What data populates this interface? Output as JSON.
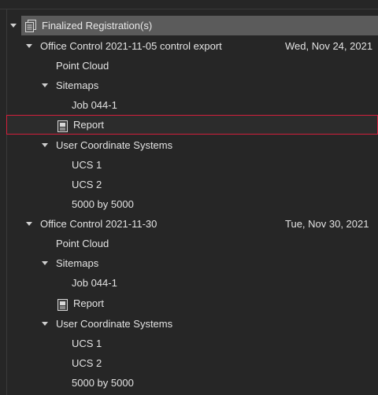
{
  "tree": {
    "root": {
      "label": "Finalized Registration(s)",
      "icon": "registration-document-icon",
      "expanded": true
    },
    "registrations": [
      {
        "title": "Office Control 2021-11-05 control export",
        "date": "Wed, Nov 24, 2021",
        "expanded": true,
        "point_cloud": "Point Cloud",
        "sitemaps": {
          "label": "Sitemaps",
          "expanded": true,
          "items": [
            "Job 044-1"
          ]
        },
        "report": {
          "label": "Report",
          "icon": "report-document-icon",
          "selected": true
        },
        "ucs": {
          "label": "User Coordinate Systems",
          "expanded": true,
          "items": [
            "UCS 1",
            "UCS 2",
            "5000 by 5000"
          ]
        }
      },
      {
        "title": "Office Control 2021-11-30",
        "date": "Tue, Nov 30, 2021",
        "expanded": true,
        "point_cloud": "Point Cloud",
        "sitemaps": {
          "label": "Sitemaps",
          "expanded": true,
          "items": [
            "Job 044-1"
          ]
        },
        "report": {
          "label": "Report",
          "icon": "report-document-icon",
          "selected": false
        },
        "ucs": {
          "label": "User Coordinate Systems",
          "expanded": true,
          "items": [
            "UCS 1",
            "UCS 2",
            "5000 by 5000"
          ]
        }
      }
    ]
  },
  "colors": {
    "background": "#262626",
    "header_bar": "#5b5b5b",
    "selection_border": "#d21f3c",
    "text": "#e3e3e3"
  }
}
